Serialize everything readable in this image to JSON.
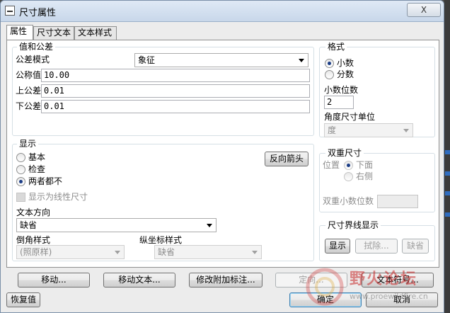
{
  "window": {
    "title": "尺寸属性",
    "close_label": "X"
  },
  "tabs": [
    {
      "label": "属性",
      "active": true
    },
    {
      "label": "尺寸文本",
      "active": false
    },
    {
      "label": "文本样式",
      "active": false
    }
  ],
  "value_tolerance": {
    "legend": "值和公差",
    "tolerance_mode_label": "公差模式",
    "tolerance_mode_value": "象征",
    "nominal_label": "公称值",
    "nominal_value": "10.00",
    "upper_label": "上公差",
    "upper_value": "0.01",
    "lower_label": "下公差",
    "lower_value": "0.01"
  },
  "format": {
    "legend": "格式",
    "decimal_label": "小数",
    "fraction_label": "分数",
    "selected": "decimal",
    "decimal_places_label": "小数位数",
    "decimal_places_value": "2",
    "angle_unit_label": "角度尺寸单位",
    "angle_unit_value": "度"
  },
  "display": {
    "legend": "显示",
    "basic_label": "基本",
    "inspect_label": "检查",
    "neither_label": "两者都不",
    "selected": "neither",
    "reverse_arrow_label": "反向箭头",
    "linear_checkbox_label": "显示为线性尺寸",
    "text_direction_label": "文本方向",
    "text_direction_value": "缺省",
    "chamfer_label": "倒角样式",
    "chamfer_value": "(照原样)",
    "ordinate_label": "纵坐标样式",
    "ordinate_value": "缺省"
  },
  "dual_dimension": {
    "legend": "双重尺寸",
    "position_label": "位置",
    "below_label": "下面",
    "right_label": "右侧",
    "dual_decimal_label": "双重小数位数"
  },
  "witness_line": {
    "legend": "尺寸界线显示",
    "show_label": "显示",
    "erase_label": "拭除...",
    "default_label": "缺省"
  },
  "buttons": {
    "move": "移动...",
    "move_text": "移动文本...",
    "modify_attached": "修改附加标注...",
    "orient": "定向...",
    "text_symbol": "文本符号...",
    "restore": "恢复值",
    "ok": "确定",
    "cancel": "取消"
  },
  "watermark": {
    "text": "野火论坛",
    "url": "www.proewildfire.cn"
  }
}
